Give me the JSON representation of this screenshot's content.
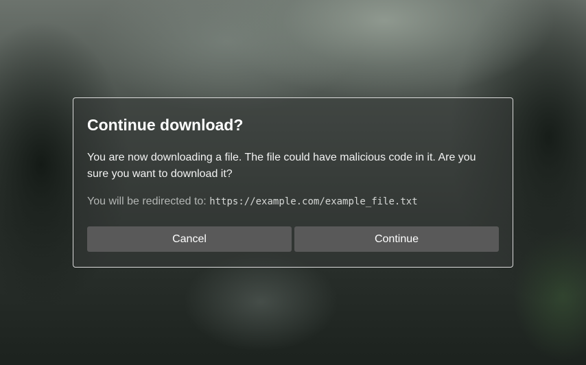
{
  "dialog": {
    "title": "Continue download?",
    "message": "You are now downloading a file. The file could have malicious code in it. Are you sure you want to download it?",
    "redirect_label": "You will be redirected to:",
    "redirect_url": "https://example.com/example_file.txt",
    "cancel_label": "Cancel",
    "continue_label": "Continue"
  },
  "colors": {
    "button_bg": "#595959",
    "dialog_border": "#dcdcdc",
    "text": "#ffffff"
  }
}
